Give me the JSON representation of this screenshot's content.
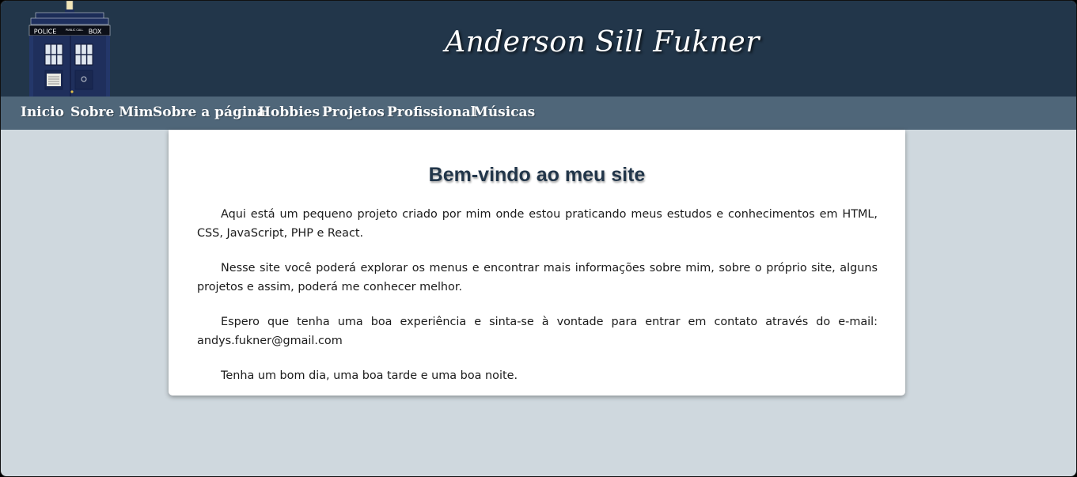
{
  "header": {
    "site_title": "Anderson Sill Fukner",
    "logo": {
      "icon": "police-box-icon",
      "sign_left": "POLICE",
      "sign_mid": "PUBLIC CALL",
      "sign_right": "BOX"
    }
  },
  "nav": {
    "items": [
      {
        "label": "Inicio"
      },
      {
        "label": "Sobre Mim"
      },
      {
        "label": "Sobre a página"
      },
      {
        "label": "Hobbies"
      },
      {
        "label": "Projetos"
      },
      {
        "label": "Profissional"
      },
      {
        "label": "Músicas"
      }
    ]
  },
  "main": {
    "title": "Bem-vindo ao meu site",
    "paragraphs": [
      "Aqui está um pequeno projeto criado por mim onde estou praticando meus estudos e conhecimentos em HTML, CSS, JavaScript, PHP e React.",
      "Nesse site você poderá explorar os menus e encontrar mais informações sobre mim, sobre o próprio site, alguns projetos e assim, poderá me conhecer melhor.",
      "Espero que tenha uma boa experiência e sinta-se à vontade para entrar em contato através do e-mail: andys.fukner@gmail.com",
      "Tenha um bom dia, uma boa tarde e uma boa noite."
    ]
  },
  "colors": {
    "header_bg": "#22364a",
    "nav_bg": "#4f6679",
    "page_bg": "#cfd8de",
    "card_bg": "#ffffff",
    "title_color": "#22364a"
  }
}
